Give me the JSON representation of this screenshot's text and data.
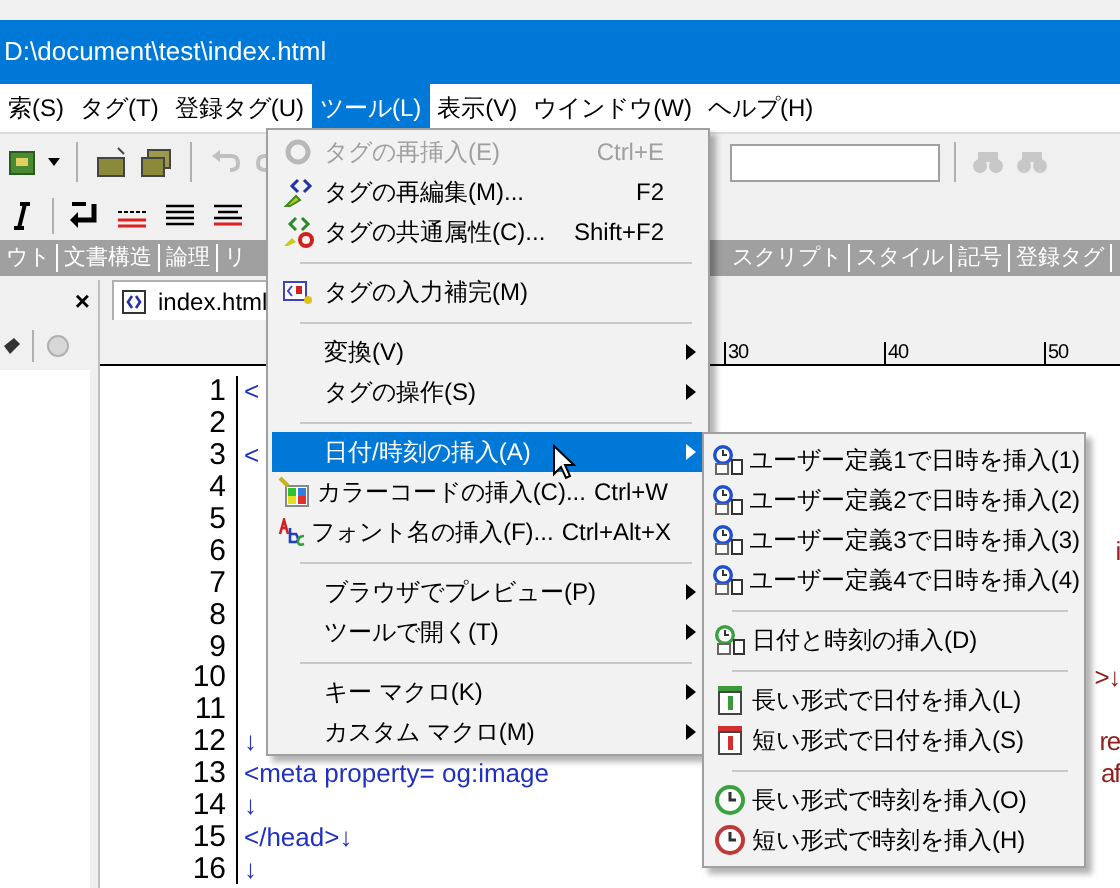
{
  "window": {
    "title": "D:\\document\\test\\index.html"
  },
  "menubar": [
    {
      "label": "索(S)",
      "selected": false
    },
    {
      "label": "タグ(T)",
      "selected": false
    },
    {
      "label": "登録タグ(U)",
      "selected": false
    },
    {
      "label": "ツール(L)",
      "selected": true
    },
    {
      "label": "表示(V)",
      "selected": false
    },
    {
      "label": "ウインドウ(W)",
      "selected": false
    },
    {
      "label": "ヘルプ(H)",
      "selected": false
    }
  ],
  "palette_bar": {
    "left": [
      "ウト",
      "文書構造",
      "論理",
      "リ"
    ],
    "right": [
      "スクリプト",
      "スタイル",
      "記号",
      "登録タグ"
    ]
  },
  "side_panel": {
    "close": "×"
  },
  "editor": {
    "tab": "index.html",
    "ruler": [
      "30",
      "40",
      "50"
    ],
    "lines": [
      {
        "number": "1",
        "left": "<"
      },
      {
        "number": "2"
      },
      {
        "number": "3",
        "left": "<"
      },
      {
        "number": "4"
      },
      {
        "number": "5"
      },
      {
        "number": "6",
        "right": "i"
      },
      {
        "number": "7"
      },
      {
        "number": "8"
      },
      {
        "number": "9"
      },
      {
        "number": "10",
        "right": ">↓"
      },
      {
        "number": "11"
      },
      {
        "number": "12",
        "left": "↓",
        "right": "re"
      },
      {
        "number": "13",
        "left": "<meta property= og:image",
        "right": "af"
      },
      {
        "number": "14",
        "left": "↓"
      },
      {
        "number": "15",
        "left": "</head>↓"
      },
      {
        "number": "16",
        "left": "↓"
      }
    ]
  },
  "menu": [
    {
      "kind": "item",
      "label": "タグの再挿入(E)",
      "shortcut": "Ctrl+E",
      "disabled": true,
      "submenu": false,
      "selected": false
    },
    {
      "kind": "item",
      "label": "タグの再編集(M)...",
      "shortcut": "F2",
      "disabled": false,
      "submenu": false,
      "selected": false
    },
    {
      "kind": "item",
      "label": "タグの共通属性(C)...",
      "shortcut": "Shift+F2",
      "disabled": false,
      "submenu": false,
      "selected": false
    },
    {
      "kind": "separator"
    },
    {
      "kind": "item",
      "label": "タグの入力補完(M)",
      "disabled": false,
      "submenu": false,
      "selected": false
    },
    {
      "kind": "separator"
    },
    {
      "kind": "item",
      "label": "変換(V)",
      "disabled": false,
      "submenu": true,
      "selected": false
    },
    {
      "kind": "item",
      "label": "タグの操作(S)",
      "disabled": false,
      "submenu": true,
      "selected": false
    },
    {
      "kind": "separator"
    },
    {
      "kind": "item",
      "label": "日付/時刻の挿入(A)",
      "disabled": false,
      "submenu": true,
      "selected": true
    },
    {
      "kind": "item",
      "label": "カラーコードの挿入(C)...",
      "shortcut": "Ctrl+W",
      "disabled": false,
      "submenu": false,
      "selected": false
    },
    {
      "kind": "item",
      "label": "フォント名の挿入(F)...",
      "shortcut": "Ctrl+Alt+X",
      "disabled": false,
      "submenu": false,
      "selected": false
    },
    {
      "kind": "separator"
    },
    {
      "kind": "item",
      "label": "ブラウザでプレビュー(P)",
      "disabled": false,
      "submenu": true,
      "selected": false
    },
    {
      "kind": "item",
      "label": "ツールで開く(T)",
      "disabled": false,
      "submenu": true,
      "selected": false
    },
    {
      "kind": "separator"
    },
    {
      "kind": "item",
      "label": "キー マクロ(K)",
      "disabled": false,
      "submenu": true,
      "selected": false
    },
    {
      "kind": "item",
      "label": "カスタム マクロ(M)",
      "disabled": false,
      "submenu": true,
      "selected": false
    }
  ],
  "submenu": [
    {
      "kind": "user",
      "color": "#1f4fd0",
      "label": "ユーザー定義1で日時を挿入(1)"
    },
    {
      "kind": "user",
      "color": "#1f4fd0",
      "label": "ユーザー定義2で日時を挿入(2)"
    },
    {
      "kind": "user",
      "color": "#1f4fd0",
      "label": "ユーザー定義3で日時を挿入(3)"
    },
    {
      "kind": "user",
      "color": "#1f4fd0",
      "label": "ユーザー定義4で日時を挿入(4)"
    },
    {
      "kind": "separator"
    },
    {
      "kind": "user",
      "color": "#3aa040",
      "label": "日付と時刻の挿入(D)"
    },
    {
      "kind": "separator"
    },
    {
      "kind": "date",
      "color": "#3a9a3a",
      "label": "長い形式で日付を挿入(L)"
    },
    {
      "kind": "date",
      "color": "#d03030",
      "label": "短い形式で日付を挿入(S)"
    },
    {
      "kind": "separator"
    },
    {
      "kind": "time",
      "color": "#3aa040",
      "label": "長い形式で時刻を挿入(O)"
    },
    {
      "kind": "time",
      "color": "#c03838",
      "label": "短い形式で時刻を挿入(H)"
    }
  ]
}
